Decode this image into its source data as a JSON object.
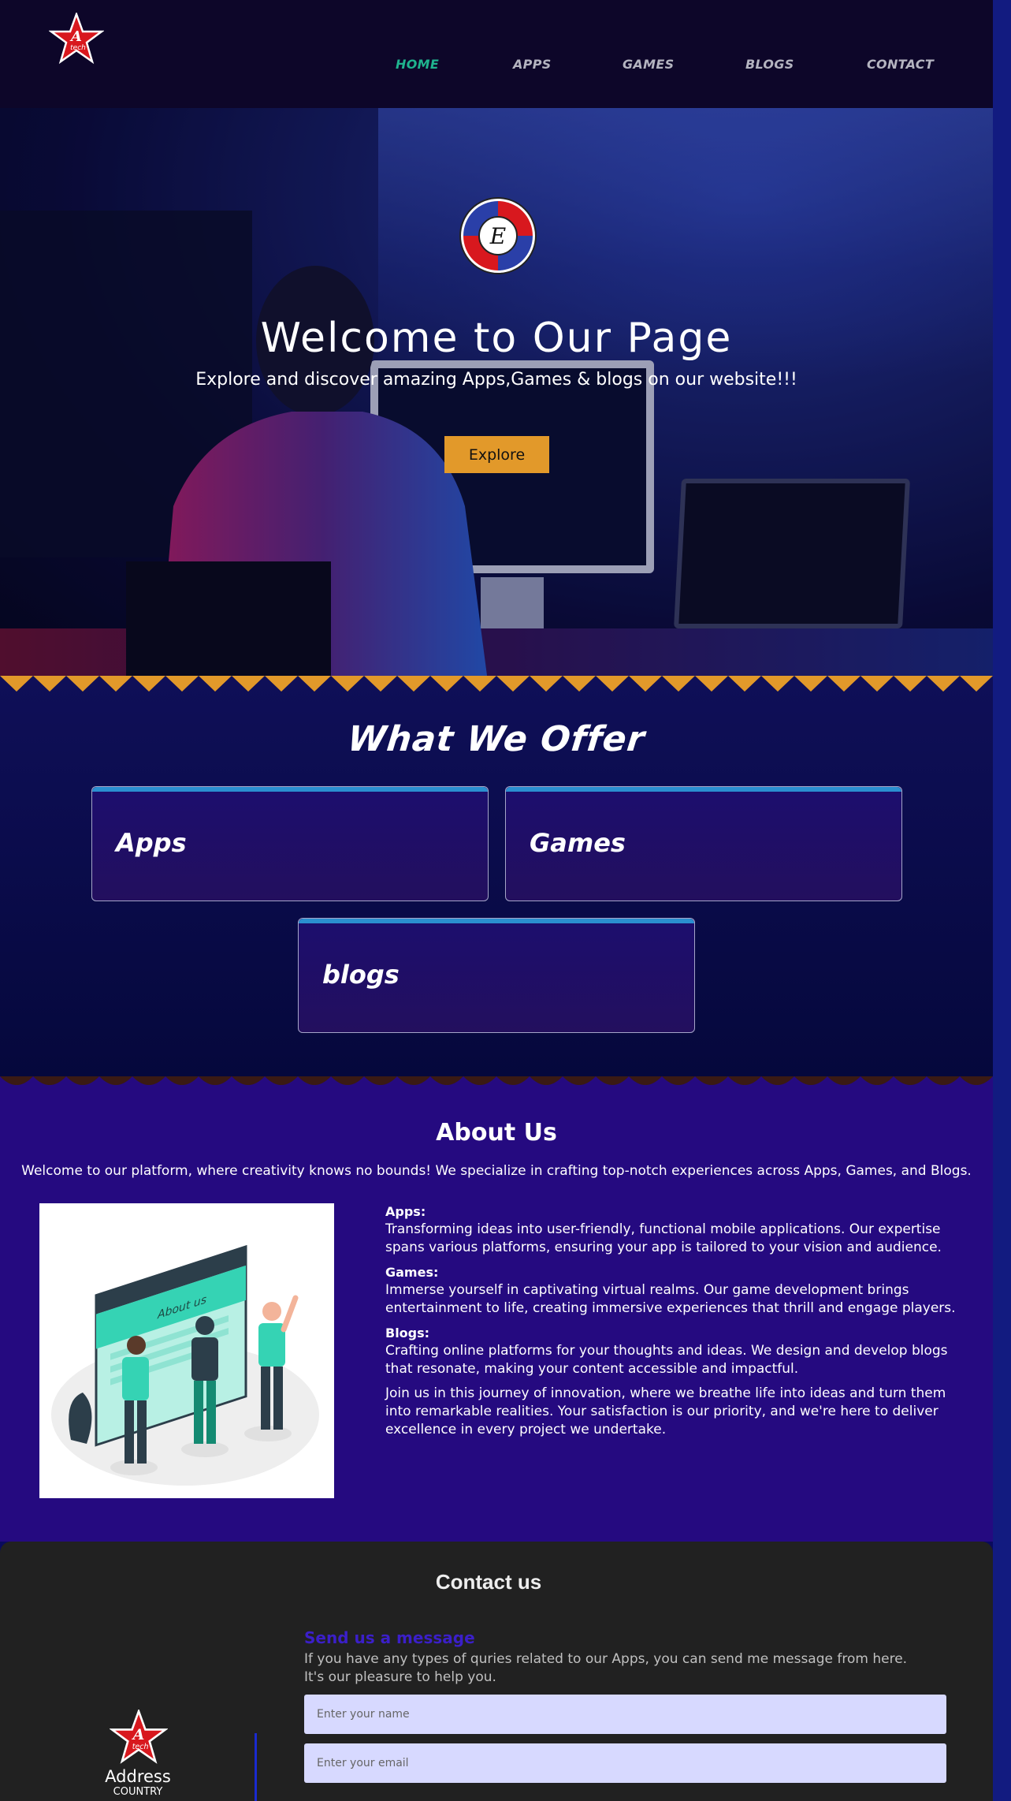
{
  "nav": {
    "items": [
      {
        "label": "HOME",
        "active": true
      },
      {
        "label": "APPS",
        "active": false
      },
      {
        "label": "GAMES",
        "active": false
      },
      {
        "label": "BLOGS",
        "active": false
      },
      {
        "label": "CONTACT",
        "active": false
      }
    ]
  },
  "hero": {
    "title": "Welcome to Our Page",
    "subtitle": "Explore and discover amazing Apps,Games & blogs on our website!!!",
    "button": "Explore",
    "badge_letter": "E"
  },
  "offer": {
    "title": "What We Offer",
    "cards": [
      "Apps",
      "Games",
      "blogs"
    ]
  },
  "about": {
    "title": "About Us",
    "intro": "Welcome to our platform, where creativity knows no bounds! We specialize in crafting top-notch experiences across Apps, Games, and Blogs.",
    "illustration_label": "About us",
    "sections": [
      {
        "heading": "Apps:",
        "body": "Transforming ideas into user-friendly, functional mobile applications. Our expertise spans various platforms, ensuring your app is tailored to your vision and audience."
      },
      {
        "heading": "Games:",
        "body": "Immerse yourself in captivating virtual realms. Our game development brings entertainment to life, creating immersive experiences that thrill and engage players."
      },
      {
        "heading": "Blogs:",
        "body": "Crafting online platforms for your thoughts and ideas. We design and develop blogs that resonate, making your content accessible and impactful."
      }
    ],
    "closing": "Join us in this journey of innovation, where we breathe life into ideas and turn them into remarkable realities. Your satisfaction is our priority, and we're here to deliver excellence in every project we undertake."
  },
  "contact": {
    "title": "Contact us",
    "address_label": "Address",
    "country": "COUNTRY",
    "send_heading": "Send us a message",
    "description": "If you have any types of quries related to our Apps, you can send me message from here. It's our pleasure to help you.",
    "name_placeholder": "Enter your name",
    "email_placeholder": "Enter your email"
  },
  "logo_text": "tech",
  "colors": {
    "accent_orange": "#e2992a",
    "nav_active": "#1fb38e",
    "about_bg": "#250a80",
    "contact_bg": "#212121"
  }
}
